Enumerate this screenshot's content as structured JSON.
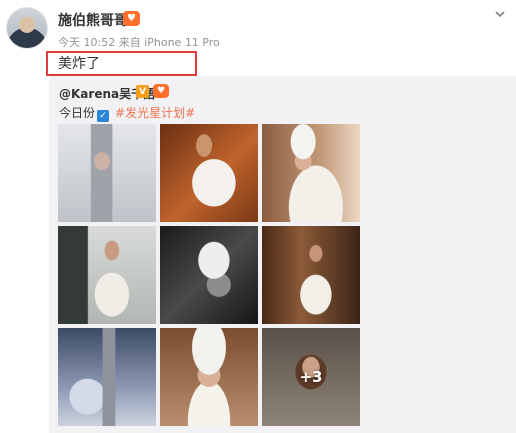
{
  "post": {
    "username": "施伯熊哥哥",
    "meta": "今天 10:52 来自 iPhone 11 Pro",
    "text": "美炸了"
  },
  "repost": {
    "user": "@Karena吴千語",
    "line2_prefix": "今日份",
    "hashtag": "#发光星计划#",
    "more_count": "+3"
  },
  "colors": {
    "hashtag": "#eb7350",
    "highlight_box": "#e23c3c",
    "repost_bg": "#f2f2f5"
  },
  "icons": [
    "avatar",
    "fan-badge-icon",
    "chevron-down-icon",
    "verified-v-icon",
    "check-icon"
  ]
}
